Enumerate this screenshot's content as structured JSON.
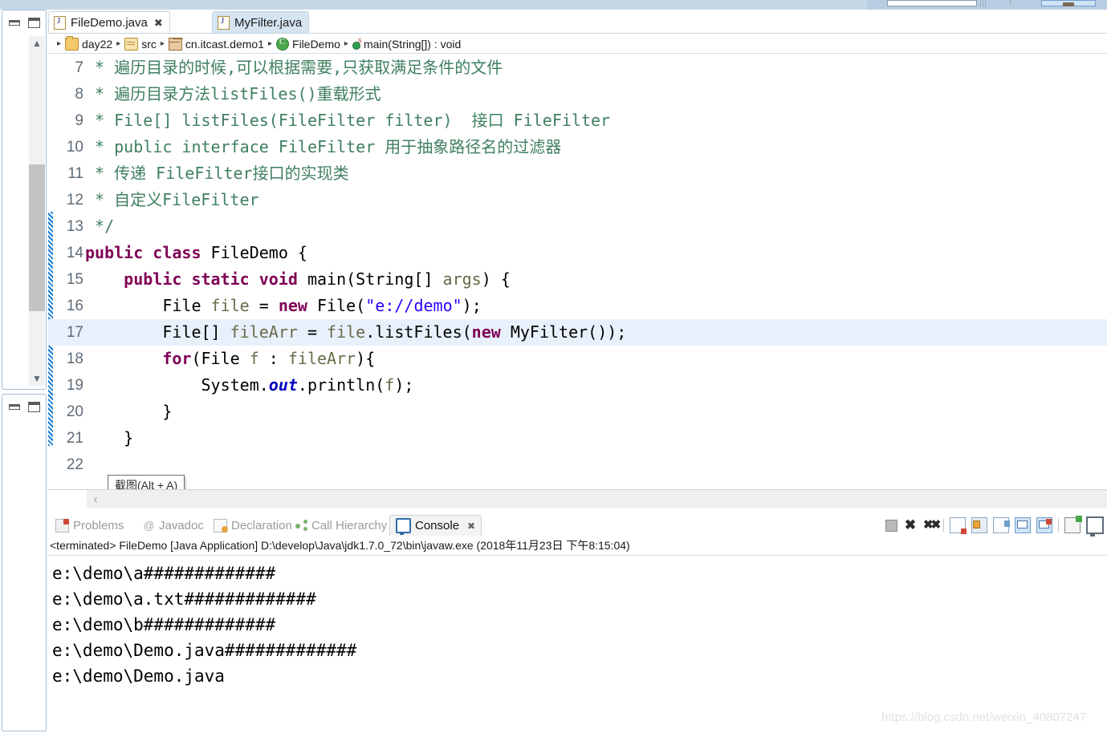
{
  "window": {
    "minimize_label": "Minimize",
    "maximize_label": "Maximize"
  },
  "editor": {
    "tabs": [
      {
        "label": "FileDemo.java",
        "active": true,
        "close": "✖"
      },
      {
        "label": "MyFilter.java",
        "active": false,
        "close": ""
      }
    ],
    "breadcrumb": [
      {
        "label": "day22",
        "icon": "folder-icon"
      },
      {
        "label": "src",
        "icon": "source-folder-icon"
      },
      {
        "label": "cn.itcast.demo1",
        "icon": "package-icon"
      },
      {
        "label": "FileDemo",
        "icon": "class-icon"
      },
      {
        "label": "main(String[]) : void",
        "icon": "method-icon"
      }
    ],
    "breadcrumb_arrow": "▸",
    "lines": [
      {
        "num": "7",
        "highlight": false,
        "tokens": [
          {
            "t": " * 遍历目录的时候,可以根据需要,只获取满足条件的文件",
            "c": "cmt"
          }
        ]
      },
      {
        "num": "8",
        "highlight": false,
        "tokens": [
          {
            "t": " * 遍历目录方法listFiles()重载形式",
            "c": "cmt"
          }
        ]
      },
      {
        "num": "9",
        "highlight": false,
        "tokens": [
          {
            "t": " * File[] listFiles(FileFilter filter)  接口 FileFilter",
            "c": "cmt"
          }
        ]
      },
      {
        "num": "10",
        "highlight": false,
        "tokens": [
          {
            "t": " * public interface FileFilter 用于抽象路径名的过滤器",
            "c": "cmt"
          }
        ]
      },
      {
        "num": "11",
        "highlight": false,
        "tokens": [
          {
            "t": " * 传递 FileFilter接口的实现类",
            "c": "cmt"
          }
        ]
      },
      {
        "num": "12",
        "highlight": false,
        "tokens": [
          {
            "t": " * 自定义FileFilter",
            "c": "cmt"
          }
        ]
      },
      {
        "num": "13",
        "highlight": false,
        "tokens": [
          {
            "t": " */",
            "c": "cmt"
          }
        ]
      },
      {
        "num": "14",
        "highlight": false,
        "tokens": [
          {
            "t": "public class ",
            "c": "kw"
          },
          {
            "t": "FileDemo {",
            "c": "plain"
          }
        ]
      },
      {
        "num": "15",
        "highlight": false,
        "tokens": [
          {
            "t": "    ",
            "c": "plain"
          },
          {
            "t": "public static void ",
            "c": "kw"
          },
          {
            "t": "main(String[] ",
            "c": "plain"
          },
          {
            "t": "args",
            "c": "loc"
          },
          {
            "t": ") {",
            "c": "plain"
          }
        ]
      },
      {
        "num": "16",
        "highlight": false,
        "tokens": [
          {
            "t": "        File ",
            "c": "plain"
          },
          {
            "t": "file",
            "c": "loc"
          },
          {
            "t": " = ",
            "c": "plain"
          },
          {
            "t": "new ",
            "c": "kw"
          },
          {
            "t": "File(",
            "c": "plain"
          },
          {
            "t": "\"e://demo\"",
            "c": "str"
          },
          {
            "t": ");",
            "c": "plain"
          }
        ]
      },
      {
        "num": "17",
        "highlight": true,
        "tokens": [
          {
            "t": "        File[] ",
            "c": "plain"
          },
          {
            "t": "fileArr",
            "c": "loc"
          },
          {
            "t": " = ",
            "c": "plain"
          },
          {
            "t": "file",
            "c": "loc"
          },
          {
            "t": ".listFiles(",
            "c": "plain"
          },
          {
            "t": "new ",
            "c": "kw"
          },
          {
            "t": "MyFilter());",
            "c": "plain"
          }
        ]
      },
      {
        "num": "18",
        "highlight": false,
        "tokens": [
          {
            "t": "        ",
            "c": "plain"
          },
          {
            "t": "for",
            "c": "kw"
          },
          {
            "t": "(File ",
            "c": "plain"
          },
          {
            "t": "f",
            "c": "loc"
          },
          {
            "t": " : ",
            "c": "plain"
          },
          {
            "t": "fileArr",
            "c": "loc"
          },
          {
            "t": "){",
            "c": "plain"
          }
        ]
      },
      {
        "num": "19",
        "highlight": false,
        "tokens": [
          {
            "t": "            System.",
            "c": "plain"
          },
          {
            "t": "out",
            "c": "fld"
          },
          {
            "t": ".println(",
            "c": "plain"
          },
          {
            "t": "f",
            "c": "loc"
          },
          {
            "t": ");",
            "c": "plain"
          }
        ]
      },
      {
        "num": "20",
        "highlight": false,
        "tokens": [
          {
            "t": "        }",
            "c": "plain"
          }
        ]
      },
      {
        "num": "21",
        "highlight": false,
        "tokens": [
          {
            "t": "    }",
            "c": "plain"
          }
        ]
      },
      {
        "num": "22",
        "highlight": false,
        "tokens": [
          {
            "t": "",
            "c": "plain"
          }
        ]
      }
    ],
    "tooltip": "截图(Alt + A)",
    "hscroll_left_arrow": "‹"
  },
  "console": {
    "tabs": [
      {
        "label": "Problems",
        "icon": "problems-icon",
        "active": false
      },
      {
        "label": "Javadoc",
        "icon": "javadoc-icon",
        "active": false
      },
      {
        "label": "Declaration",
        "icon": "declaration-icon",
        "active": false
      },
      {
        "label": "Call Hierarchy",
        "icon": "call-hierarchy-icon",
        "active": false
      },
      {
        "label": "Console",
        "icon": "console-icon",
        "active": true
      }
    ],
    "active_close": "✖",
    "toolbar": [
      {
        "name": "terminate-button",
        "glyph": ""
      },
      {
        "name": "remove-launch-button",
        "glyph": "✖"
      },
      {
        "name": "remove-all-launches-button",
        "glyph": "✖"
      },
      {
        "name": "clear-console-button",
        "glyph": ""
      },
      {
        "name": "scroll-lock-button",
        "glyph": ""
      },
      {
        "name": "pin-console-button",
        "glyph": ""
      },
      {
        "name": "display-selected-console-button",
        "glyph": ""
      },
      {
        "name": "show-console-on-output-button",
        "glyph": ""
      },
      {
        "name": "open-console-button",
        "glyph": ""
      },
      {
        "name": "minimize-console-button",
        "glyph": ""
      }
    ],
    "status": "<terminated> FileDemo [Java Application] D:\\develop\\Java\\jdk1.7.0_72\\bin\\javaw.exe (2018年11月23日 下午8:15:04)",
    "output": [
      "e:\\demo\\a#############",
      "e:\\demo\\a.txt#############",
      "e:\\demo\\b#############",
      "e:\\demo\\Demo.java#############",
      "e:\\demo\\Demo.java"
    ]
  },
  "watermark": "https://blog.csdn.net/weixin_40807247",
  "colors": {
    "comment": "#3f7f5f",
    "keyword": "#7f0055",
    "string": "#2a00ff",
    "field": "#0000c0",
    "local": "#6a6a4a",
    "line_highlight": "#e8f1fb",
    "tab_inactive_bg": "#d5e4f1"
  }
}
